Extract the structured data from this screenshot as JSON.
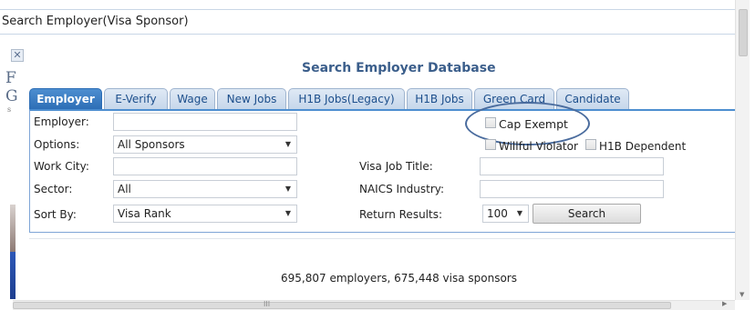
{
  "window": {
    "title": "Search Employer(Visa Sponsor)"
  },
  "background": {
    "close_glyph": "✕",
    "letter_1": "F",
    "letter_2": "G",
    "letter_3": "s"
  },
  "page": {
    "title": "Search Employer Database"
  },
  "tabs": [
    {
      "label": "Employer",
      "active": true
    },
    {
      "label": "E-Verify",
      "active": false
    },
    {
      "label": "Wage",
      "active": false
    },
    {
      "label": "New Jobs",
      "active": false
    },
    {
      "label": "H1B Jobs(Legacy)",
      "active": false
    },
    {
      "label": "H1B Jobs",
      "active": false
    },
    {
      "label": "Green Card",
      "active": false
    },
    {
      "label": "Candidate",
      "active": false
    }
  ],
  "form": {
    "employer": {
      "label": "Employer:",
      "value": ""
    },
    "options": {
      "label": "Options:",
      "value": "All Sponsors"
    },
    "work_city": {
      "label": "Work City:",
      "value": ""
    },
    "sector": {
      "label": "Sector:",
      "value": "All"
    },
    "sort_by": {
      "label": "Sort By:",
      "value": "Visa Rank"
    },
    "visa_job_title": {
      "label": "Visa Job Title:",
      "value": ""
    },
    "naics_industry": {
      "label": "NAICS Industry:",
      "value": ""
    },
    "return_results": {
      "label": "Return Results:",
      "value": "100"
    },
    "cap_exempt": {
      "label": "Cap Exempt",
      "checked": false
    },
    "willful_violator": {
      "label": "Willful Violator",
      "checked": false
    },
    "h1b_dependent": {
      "label": "H1B Dependent",
      "checked": false
    },
    "search_button": "Search"
  },
  "stats": {
    "text": "695,807 employers, 675,448 visa sponsors"
  },
  "scrollbar": {
    "grip": "III"
  },
  "colors": {
    "accent": "#2c6db5",
    "title": "#3b5e8b",
    "tab_inactive": "#c5d6ea",
    "annotation": "#4a6c9e"
  },
  "icons": {
    "caret": "caret-down-icon",
    "close": "close-icon"
  }
}
